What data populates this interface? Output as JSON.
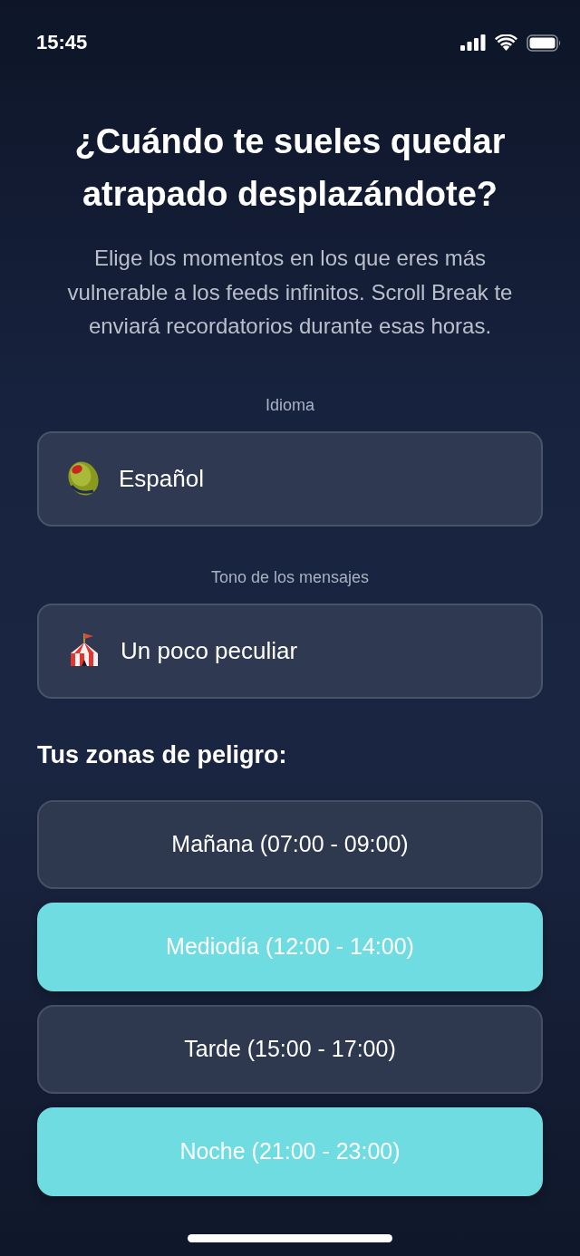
{
  "status_bar": {
    "time": "15:45"
  },
  "title": "¿Cuándo te sueles quedar atrapado desplazándote?",
  "subtitle": "Elige los momentos en los que eres más vulnerable a los feeds infinitos. Scroll Break te enviará recordatorios durante esas horas.",
  "fields": [
    {
      "label": "Idioma",
      "value": "Español"
    },
    {
      "label": "Tono de los mensajes",
      "value": "Un poco peculiar"
    }
  ],
  "danger_zones": {
    "heading": "Tus zonas de peligro:",
    "options": [
      {
        "label": "Mañana (07:00 - 09:00)",
        "selected": false
      },
      {
        "label": "Mediodía (12:00 - 14:00)",
        "selected": true
      },
      {
        "label": "Tarde (15:00 - 17:00)",
        "selected": false
      },
      {
        "label": "Noche (21:00 - 23:00)",
        "selected": true
      }
    ]
  }
}
